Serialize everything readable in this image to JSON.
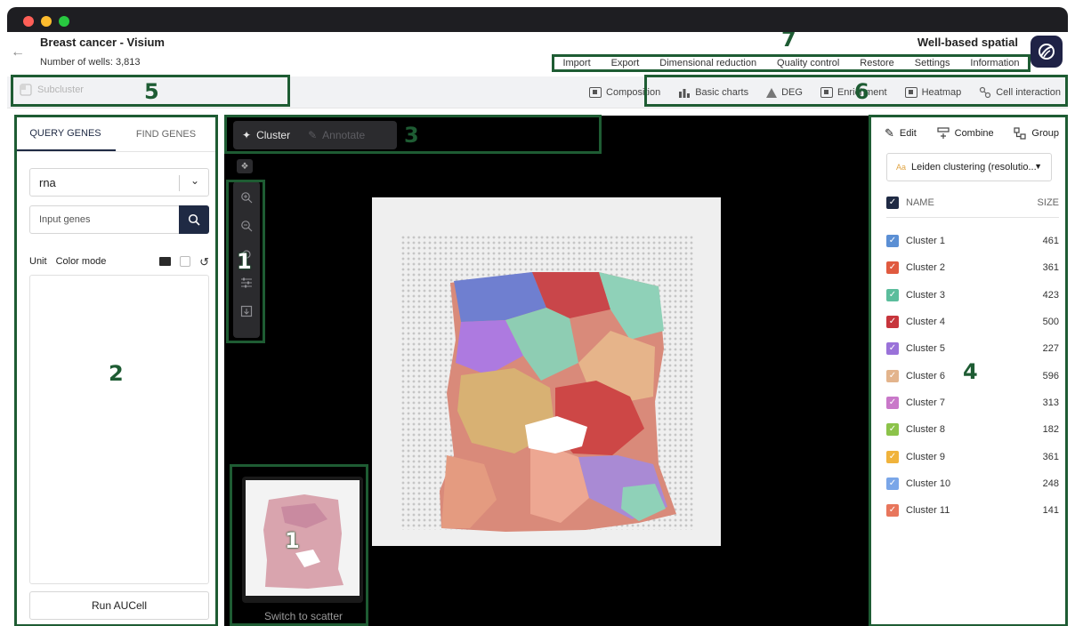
{
  "header": {
    "title": "Breast cancer - Visium",
    "wells_count": "Number of wells: 3,813",
    "mode_title": "Well-based spatial",
    "menu": [
      "Import",
      "Export",
      "Dimensional reduction",
      "Quality control",
      "Restore",
      "Settings",
      "Information"
    ]
  },
  "toolbar": {
    "subcluster_label": "Subcluster",
    "items": [
      "Composition",
      "Basic charts",
      "DEG",
      "Enrichment",
      "Heatmap",
      "Cell interaction"
    ]
  },
  "left_panel": {
    "tabs": [
      "QUERY GENES",
      "FIND GENES"
    ],
    "active_tab": "QUERY GENES",
    "data_type": "rna",
    "gene_input_placeholder": "Input genes",
    "unit_label": "Unit",
    "color_mode_label": "Color mode",
    "run_button": "Run AUCell"
  },
  "viewer": {
    "cluster_mode": "Cluster",
    "annotate_mode": "Annotate",
    "switch_label": "Switch to scatter"
  },
  "right_panel": {
    "actions": [
      "Edit",
      "Combine",
      "Group"
    ],
    "clustering_aa": "Aa",
    "clustering_selected": "Leiden clustering (resolutio...",
    "col_name": "NAME",
    "col_size": "SIZE",
    "clusters": [
      {
        "name": "Cluster 1",
        "size": "461",
        "color": "#5b8fd4"
      },
      {
        "name": "Cluster 2",
        "size": "361",
        "color": "#e05a3f"
      },
      {
        "name": "Cluster 3",
        "size": "423",
        "color": "#5bbd9c"
      },
      {
        "name": "Cluster 4",
        "size": "500",
        "color": "#c7353c"
      },
      {
        "name": "Cluster 5",
        "size": "227",
        "color": "#9a72d9"
      },
      {
        "name": "Cluster 6",
        "size": "596",
        "color": "#e3b48c"
      },
      {
        "name": "Cluster 7",
        "size": "313",
        "color": "#c978c9"
      },
      {
        "name": "Cluster 8",
        "size": "182",
        "color": "#8cc34a"
      },
      {
        "name": "Cluster 9",
        "size": "361",
        "color": "#f0b33c"
      },
      {
        "name": "Cluster 10",
        "size": "248",
        "color": "#7aa6e8"
      },
      {
        "name": "Cluster 11",
        "size": "141",
        "color": "#e8765c"
      }
    ]
  },
  "annotations": [
    "1",
    "1",
    "2",
    "3",
    "4",
    "5",
    "6",
    "7"
  ],
  "colors": {
    "annotation": "#1e5c33",
    "primary": "#1f2a44",
    "viewer_bg": "#000000"
  }
}
